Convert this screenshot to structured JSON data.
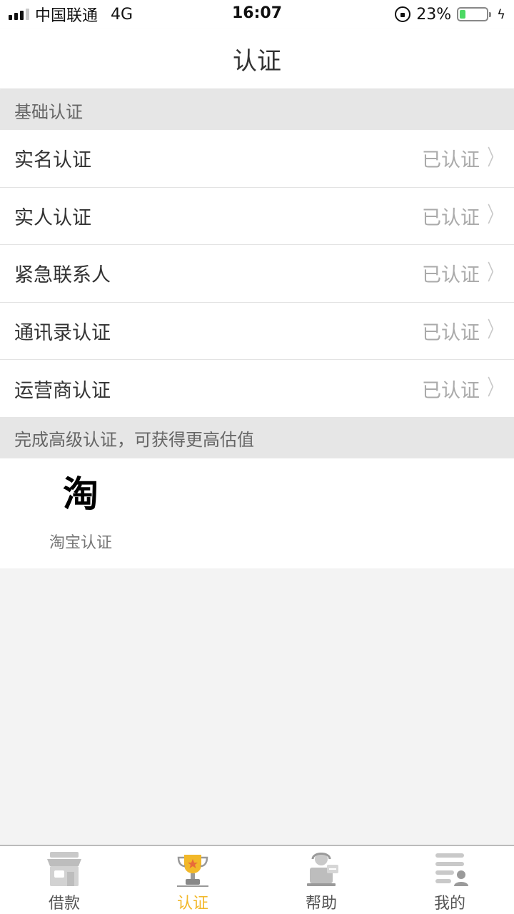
{
  "status_bar": {
    "carrier": "中国联通",
    "network": "4G",
    "time": "16:07",
    "battery": "23%",
    "battery_level": 0.23
  },
  "header": {
    "title": "认证"
  },
  "basic_section": {
    "title": "基础认证",
    "items": [
      {
        "label": "实名认证",
        "status": "已认证"
      },
      {
        "label": "实人认证",
        "status": "已认证"
      },
      {
        "label": "紧急联系人",
        "status": "已认证"
      },
      {
        "label": "通讯录认证",
        "status": "已认证"
      },
      {
        "label": "运营商认证",
        "status": "已认证"
      }
    ]
  },
  "advanced_section": {
    "title": "完成高级认证，可获得更高估值",
    "items": [
      {
        "logo_text": "淘",
        "label": "淘宝认证"
      }
    ]
  },
  "tab_bar": {
    "tabs": [
      {
        "label": "借款",
        "icon": "shop-icon",
        "active": false
      },
      {
        "label": "认证",
        "icon": "trophy-icon",
        "active": true
      },
      {
        "label": "帮助",
        "icon": "support-icon",
        "active": false
      },
      {
        "label": "我的",
        "icon": "profile-list-icon",
        "active": false
      }
    ]
  },
  "colors": {
    "accent": "#f2b829",
    "section_bg": "#e6e6e6",
    "page_bg": "#f3f3f3",
    "status_gray": "#aaaaaa"
  }
}
